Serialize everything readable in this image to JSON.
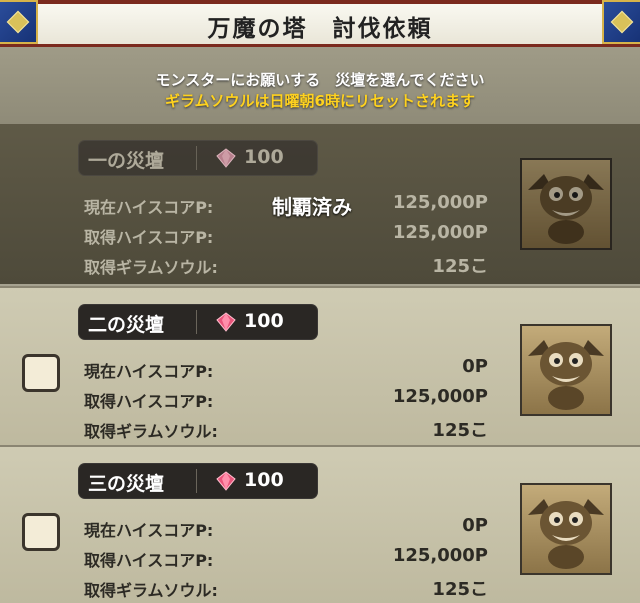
{
  "header": {
    "title": "万魔の塔　討伐依頼"
  },
  "notice": {
    "line1": "モンスターにお願いする　災壇を選んでください",
    "line2": "ギラムソウルは日曜朝6時にリセットされます"
  },
  "labels": {
    "high_score": "現在ハイスコアP:",
    "earned_score": "取得ハイスコアP:",
    "earned_soul": "取得ギラムソウル:"
  },
  "altars": [
    {
      "name": "一の災壇",
      "cost": "100",
      "current_score": "125,000P",
      "earned_score": "125,000P",
      "earned_soul": "125こ",
      "status": "制覇済み"
    },
    {
      "name": "二の災壇",
      "cost": "100",
      "current_score": "0P",
      "earned_score": "125,000P",
      "earned_soul": "125こ"
    },
    {
      "name": "三の災壇",
      "cost": "100",
      "current_score": "0P",
      "earned_score": "125,000P",
      "earned_soul": "125こ"
    }
  ],
  "icons": {
    "gem": "pink-gem-icon",
    "portrait": "bat-monster-portrait"
  },
  "colors": {
    "header_border": "#7b2a1e",
    "notice_highlight": "#ffd21e",
    "gem": "#e8557a"
  }
}
